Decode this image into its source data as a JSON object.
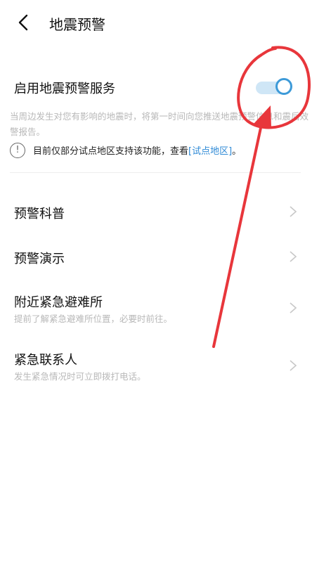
{
  "header": {
    "title": "地震预警",
    "back_icon": "chevron-left-icon"
  },
  "service": {
    "label": "启用地震预警服务",
    "toggle_on": true,
    "description": "当周边发生对您有影响的地震时，将第一时间向您推送地震预警信息和震后效警报告。"
  },
  "notice": {
    "icon": "info-icon",
    "text": "目前仅部分试点地区支持该功能，查看",
    "link": "[试点地区]",
    "suffix": "。"
  },
  "menu": [
    {
      "title": "预警科普",
      "subtitle": ""
    },
    {
      "title": "预警演示",
      "subtitle": ""
    },
    {
      "title": "附近紧急避难所",
      "subtitle": "提前了解紧急避难所位置，必要时前往。"
    },
    {
      "title": "紧急联系人",
      "subtitle": "发生紧急情况时可立即拨打电话。"
    }
  ],
  "colors": {
    "accent": "#3d9ad8",
    "annotation": "#e8363b"
  }
}
